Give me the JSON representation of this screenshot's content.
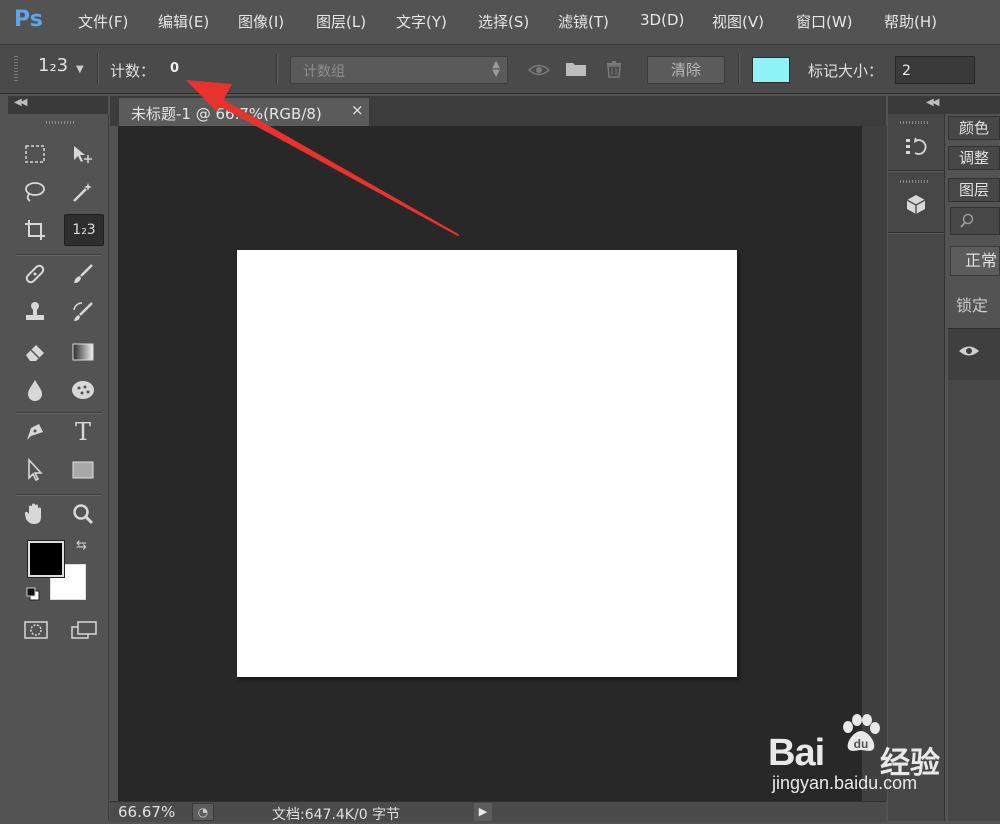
{
  "app": {
    "logo": "Ps"
  },
  "menu": [
    "文件(F)",
    "编辑(E)",
    "图像(I)",
    "图层(L)",
    "文字(Y)",
    "选择(S)",
    "滤镜(T)",
    "3D(D)",
    "视图(V)",
    "窗口(W)",
    "帮助(H)"
  ],
  "options_bar": {
    "tool_icon": "1₂3",
    "count_label": "计数：",
    "count_value": "0",
    "group_select": "计数组",
    "clear_label": "清除",
    "color_swatch": "#8ff3f7",
    "marker_size_label": "标记大小：",
    "marker_size_value": "2"
  },
  "toolbox": {
    "count_tool_label": "1₂3",
    "type_tool_label": "T",
    "foreground_color": "#000000",
    "background_color": "#ffffff"
  },
  "document": {
    "tab_title": "未标题-1 @ 66.7%(RGB/8)",
    "tab_close": "×",
    "canvas_color": "#ffffff"
  },
  "status": {
    "zoom": "66.67%",
    "doc_info": "文档:647.4K/0 字节"
  },
  "right_panels": {
    "tabs": [
      "颜色",
      "调整",
      "图层"
    ],
    "blend_mode": "正常",
    "lock_label": "锁定"
  },
  "annotation": {
    "color": "#e8322e"
  },
  "watermark": {
    "brand": "Bai",
    "brand_suffix": "经验",
    "url": "jingyan.baidu.com"
  }
}
